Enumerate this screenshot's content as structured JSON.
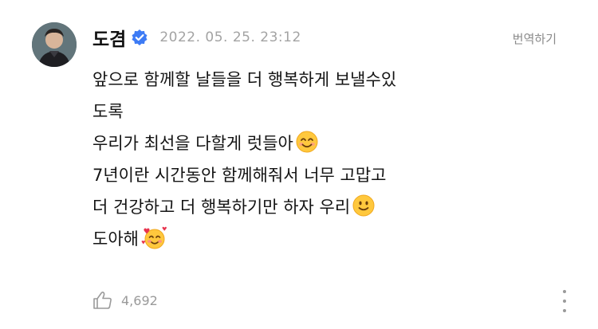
{
  "post": {
    "author": "도겸",
    "timestamp": "2022. 05. 25. 23:12",
    "translate_label": "번역하기",
    "lines": [
      "앞으로 함께할 날들을 더 행복하게 보낼수있",
      "도록",
      "우리가 최선을 다할게 럿들아",
      "7년이란 시간동안 함께해줘서 너무 고맙고",
      "더 건강하고 더 행복하기만 하자 우리",
      "도아해"
    ],
    "emojis": [
      "smiling-face-with-smiling-eyes",
      "slightly-smiling-face",
      "smiling-face-with-hearts"
    ],
    "like_count": "4,692"
  },
  "colors": {
    "verified": "#3d7bf5",
    "emoji_yellow": "#ffc83d",
    "heart": "#e8344e",
    "muted_text": "#9a9a9a"
  }
}
